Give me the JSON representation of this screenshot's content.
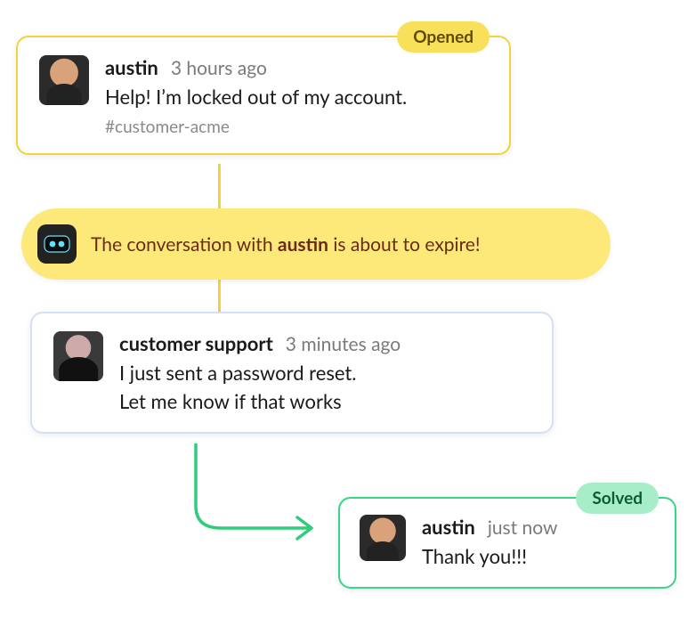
{
  "badges": {
    "opened": "Opened",
    "solved": "Solved"
  },
  "message1": {
    "username": "austin",
    "timestamp": "3 hours ago",
    "text": "Help! I’m locked out of my account.",
    "channel": "#customer-acme"
  },
  "bot": {
    "text_prefix": "The conversation with ",
    "username": "austin",
    "text_suffix": " is about to expire!"
  },
  "message2": {
    "username": "customer support",
    "timestamp": "3 minutes ago",
    "line1": "I just sent a password reset.",
    "line2": "Let me know if that works"
  },
  "message3": {
    "username": "austin",
    "timestamp": "just now",
    "text": "Thank you!!!"
  },
  "colors": {
    "yellow_border": "#f2d339",
    "blue_border": "#d6dff7",
    "green_border": "#3bd58a",
    "arrow_green": "#2ecd7b"
  }
}
